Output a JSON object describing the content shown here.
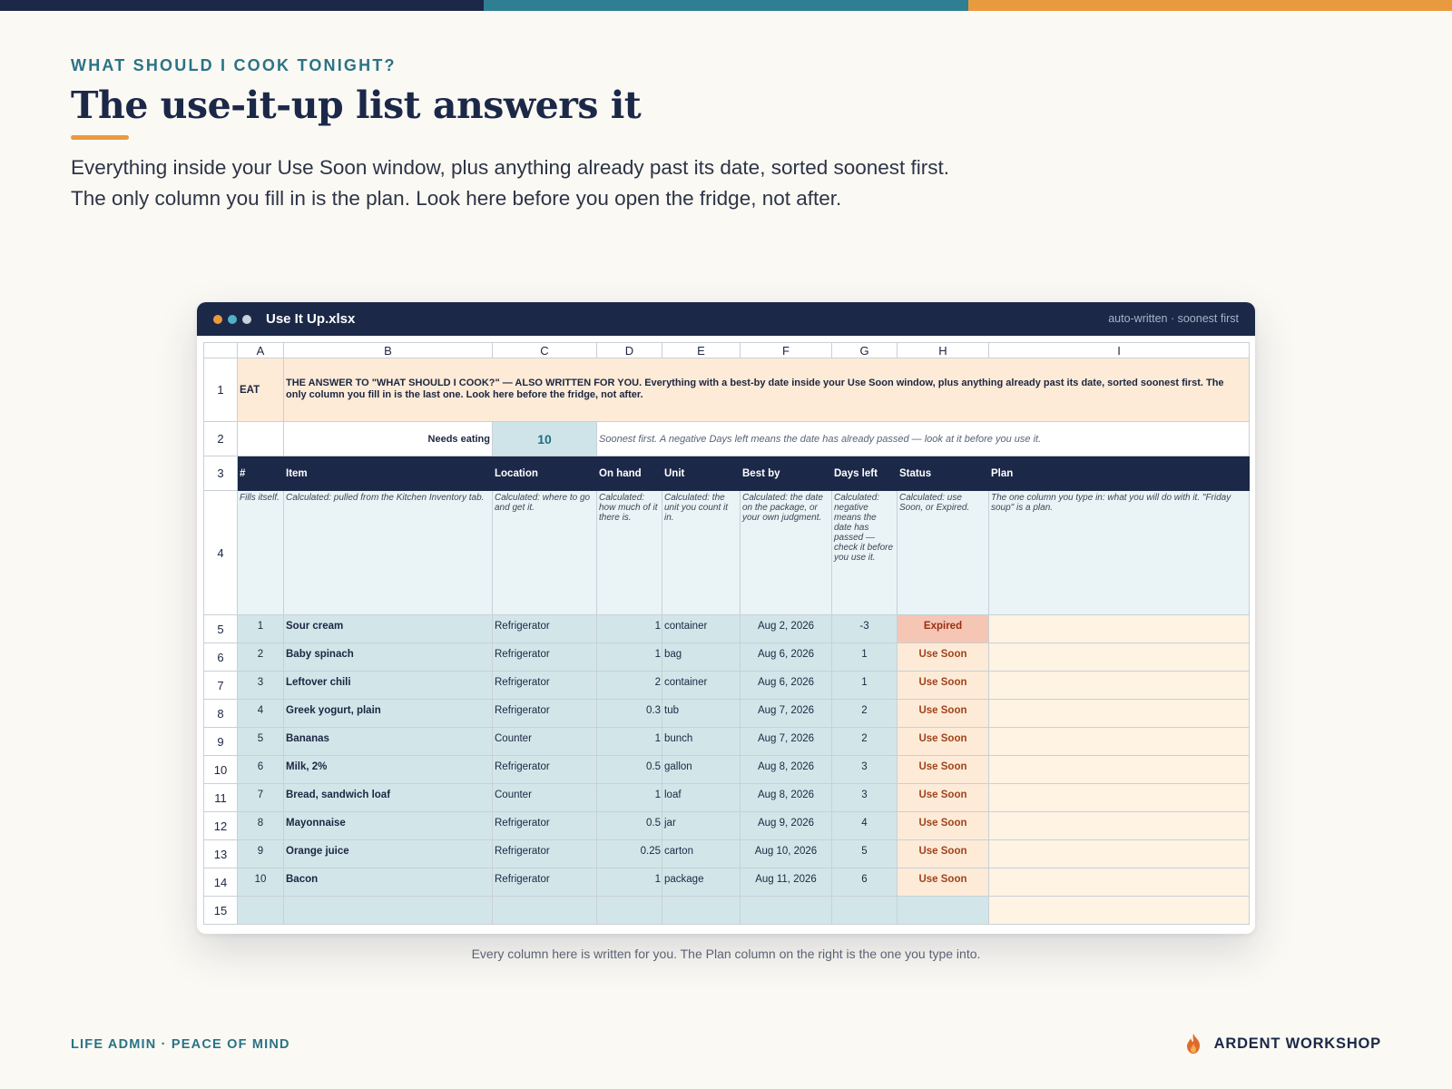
{
  "eyebrow": "WHAT SHOULD I COOK TONIGHT?",
  "headline": "The use-it-up list answers it",
  "intro": "Everything inside your Use Soon window, plus anything already past its date, sorted soonest first. The only column you fill in is the plan. Look here before you open the fridge, not after.",
  "window": {
    "title": "Use It Up.xlsx",
    "meta": "auto-written · soonest first"
  },
  "sheet": {
    "col_letters": [
      "A",
      "B",
      "C",
      "D",
      "E",
      "F",
      "G",
      "H",
      "I"
    ],
    "row_numbers": [
      "1",
      "2",
      "3",
      "4",
      "5",
      "6",
      "7",
      "8",
      "9",
      "10",
      "11",
      "12",
      "13",
      "14",
      "15"
    ],
    "row1": {
      "tag": "EAT",
      "banner": "THE ANSWER TO \"WHAT SHOULD I COOK?\" — ALSO WRITTEN FOR YOU. Everything with a best-by date inside your Use Soon window, plus anything already past its date, sorted soonest first. The only column you fill in is the last one. Look here before the fridge, not after."
    },
    "row2": {
      "label": "Needs eating",
      "value": "10",
      "note": "Soonest first. A negative Days left means the date has already passed — look at it before you use it."
    },
    "headers": [
      "#",
      "Item",
      "Location",
      "On hand",
      "Unit",
      "Best by",
      "Days left",
      "Status",
      "Plan"
    ],
    "descriptions": [
      "Fills itself.",
      "Calculated: pulled from the Kitchen Inventory tab.",
      "Calculated: where to go and get it.",
      "Calculated: how much of it there is.",
      "Calculated: the unit you count it in.",
      "Calculated: the date on the package, or your own judgment.",
      "Calculated: negative means the date has passed — check it before you use it.",
      "Calculated: use Soon, or Expired.",
      "The one column you type in: what you will do with it. \"Friday soup\" is a plan."
    ],
    "rows": [
      {
        "n": "1",
        "item": "Sour cream",
        "location": "Refrigerator",
        "on_hand": "1",
        "unit": "container",
        "best_by": "Aug 2, 2026",
        "days_left": "-3",
        "status": "Expired",
        "plan": ""
      },
      {
        "n": "2",
        "item": "Baby spinach",
        "location": "Refrigerator",
        "on_hand": "1",
        "unit": "bag",
        "best_by": "Aug 6, 2026",
        "days_left": "1",
        "status": "Use Soon",
        "plan": ""
      },
      {
        "n": "3",
        "item": "Leftover chili",
        "location": "Refrigerator",
        "on_hand": "2",
        "unit": "container",
        "best_by": "Aug 6, 2026",
        "days_left": "1",
        "status": "Use Soon",
        "plan": ""
      },
      {
        "n": "4",
        "item": "Greek yogurt, plain",
        "location": "Refrigerator",
        "on_hand": "0.3",
        "unit": "tub",
        "best_by": "Aug 7, 2026",
        "days_left": "2",
        "status": "Use Soon",
        "plan": ""
      },
      {
        "n": "5",
        "item": "Bananas",
        "location": "Counter",
        "on_hand": "1",
        "unit": "bunch",
        "best_by": "Aug 7, 2026",
        "days_left": "2",
        "status": "Use Soon",
        "plan": ""
      },
      {
        "n": "6",
        "item": "Milk, 2%",
        "location": "Refrigerator",
        "on_hand": "0.5",
        "unit": "gallon",
        "best_by": "Aug 8, 2026",
        "days_left": "3",
        "status": "Use Soon",
        "plan": ""
      },
      {
        "n": "7",
        "item": "Bread, sandwich loaf",
        "location": "Counter",
        "on_hand": "1",
        "unit": "loaf",
        "best_by": "Aug 8, 2026",
        "days_left": "3",
        "status": "Use Soon",
        "plan": ""
      },
      {
        "n": "8",
        "item": "Mayonnaise",
        "location": "Refrigerator",
        "on_hand": "0.5",
        "unit": "jar",
        "best_by": "Aug 9, 2026",
        "days_left": "4",
        "status": "Use Soon",
        "plan": ""
      },
      {
        "n": "9",
        "item": "Orange juice",
        "location": "Refrigerator",
        "on_hand": "0.25",
        "unit": "carton",
        "best_by": "Aug 10, 2026",
        "days_left": "5",
        "status": "Use Soon",
        "plan": ""
      },
      {
        "n": "10",
        "item": "Bacon",
        "location": "Refrigerator",
        "on_hand": "1",
        "unit": "package",
        "best_by": "Aug 11, 2026",
        "days_left": "6",
        "status": "Use Soon",
        "plan": ""
      }
    ]
  },
  "caption": "Every column here is written for you. The Plan column on the right is the one you type into.",
  "footer": {
    "left": "LIFE ADMIN · PEACE OF MIND",
    "brand": "ARDENT WORKSHOP",
    "brand_icon": "flame-icon"
  },
  "colors": {
    "navy": "#1b2848",
    "teal": "#2d7f91",
    "orange": "#ea9a3e",
    "expired": "#f5c6b4",
    "use_soon": "#fdebd8"
  }
}
